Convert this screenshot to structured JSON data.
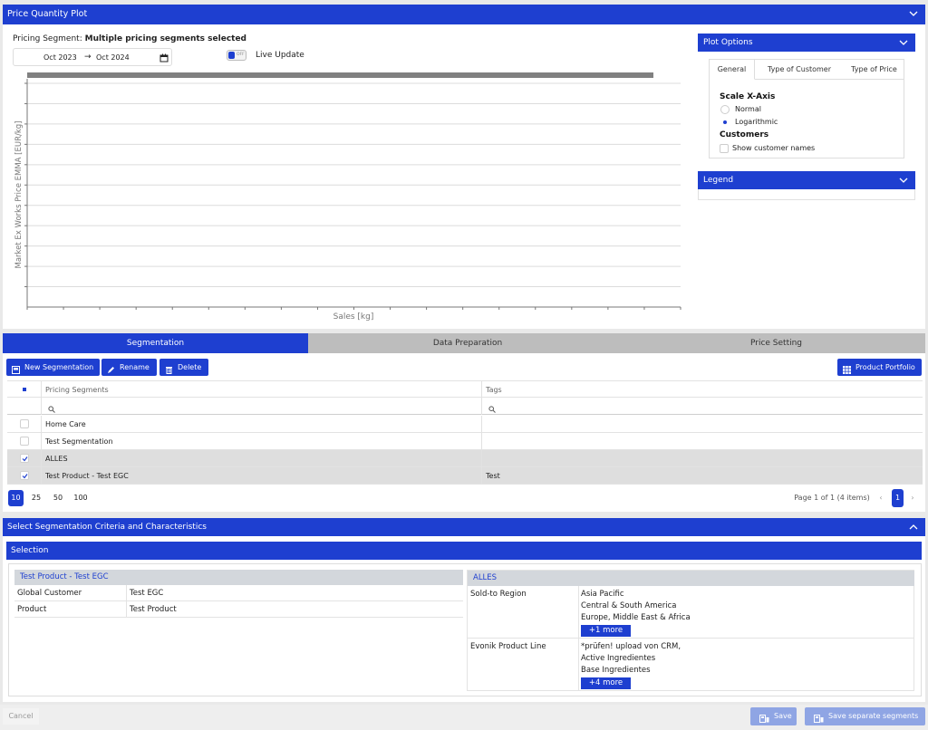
{
  "top_panel": {
    "title": "Price Quantity Plot",
    "segment_prefix": "Pricing Segment:",
    "segment_value": "Multiple pricing segments selected",
    "date_from": "Oct 2023",
    "date_arrow": "→",
    "date_to": "Oct 2024",
    "toggle_state": "OFF",
    "live_update_label": "Live Update"
  },
  "chart_data": {
    "type": "scatter",
    "title": "",
    "xlabel": "Sales [kg]",
    "ylabel": "Market Ex Works Price EMMA [EUR/kg]",
    "series": [],
    "grid": true,
    "horizontal_gridlines": 11,
    "x_ticks": 18
  },
  "plot_options": {
    "title": "Plot Options",
    "tabs": [
      "General",
      "Type of Customer",
      "Type of Price"
    ],
    "active_tab": "General",
    "scale_heading": "Scale X-Axis",
    "scale_options": [
      {
        "label": "Normal",
        "selected": false
      },
      {
        "label": "Logarithmic",
        "selected": true
      }
    ],
    "customers_heading": "Customers",
    "show_names_label": "Show customer names",
    "show_names_checked": false
  },
  "legend": {
    "title": "Legend"
  },
  "main_tabs": [
    {
      "label": "Segmentation",
      "active": true
    },
    {
      "label": "Data Preparation",
      "active": false
    },
    {
      "label": "Price Setting",
      "active": false
    }
  ],
  "toolbar": {
    "new_segmentation": "New Segmentation",
    "rename": "Rename",
    "delete": "Delete",
    "product_portfolio": "Product Portfolio"
  },
  "grid": {
    "columns": [
      "Pricing Segments",
      "Tags"
    ],
    "rows": [
      {
        "name": "Home Care",
        "tags": "",
        "checked": false
      },
      {
        "name": "Test Segmentation",
        "tags": "",
        "checked": false
      },
      {
        "name": "ALLES",
        "tags": "",
        "checked": true
      },
      {
        "name": "Test Product - Test EGC",
        "tags": "Test",
        "checked": true
      }
    ],
    "page_sizes": [
      "10",
      "25",
      "50",
      "100"
    ],
    "active_page_size": "10",
    "page_info": "Page 1 of 1 (4 items)",
    "current_page": "1"
  },
  "criteria": {
    "title": "Select Segmentation Criteria and Characteristics",
    "selection_title": "Selection",
    "cards": [
      {
        "title": "Test Product - Test EGC",
        "rows": [
          {
            "key": "Global Customer",
            "values": [
              "Test EGC"
            ],
            "more": ""
          },
          {
            "key": "Product",
            "values": [
              "Test Product"
            ],
            "more": ""
          }
        ]
      },
      {
        "title": "ALLES",
        "rows": [
          {
            "key": "Sold-to Region",
            "values": [
              "Asia Pacific",
              "Central & South America",
              "Europe, Middle East & Africa"
            ],
            "more": "+1 more"
          },
          {
            "key": "Evonik Product Line",
            "values": [
              "*prüfen! upload von CRM,",
              "Active Ingredientes",
              "Base Ingredientes"
            ],
            "more": "+4 more"
          }
        ]
      }
    ]
  },
  "footer": {
    "cancel": "Cancel",
    "save": "Save",
    "save_separate": "Save separate segments"
  }
}
